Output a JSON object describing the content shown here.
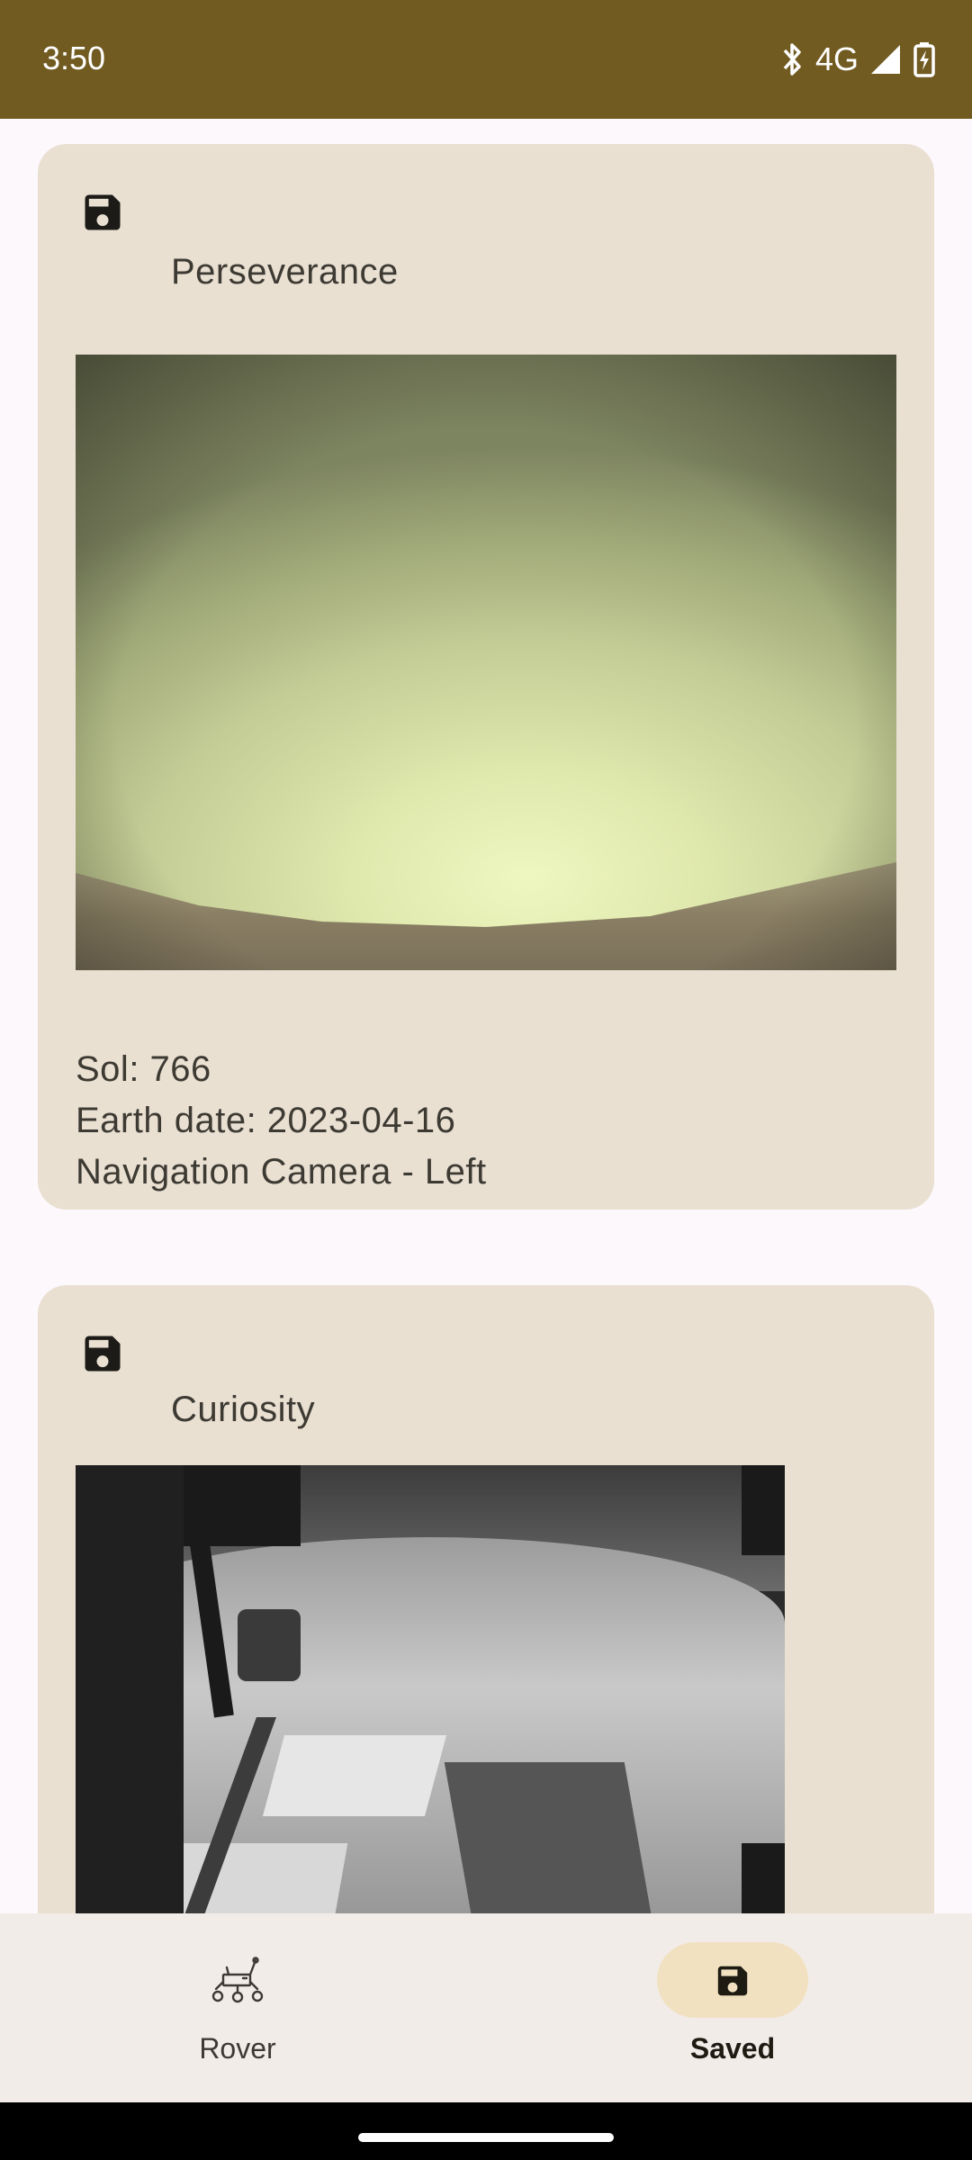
{
  "status_bar": {
    "time": "3:50",
    "network": "4G",
    "icons": [
      "bluetooth-icon",
      "signal-icon",
      "battery-charging-icon"
    ]
  },
  "cards": [
    {
      "rover_name": "Perseverance",
      "sol": "Sol: 766",
      "earth_date": "Earth date: 2023-04-16",
      "camera": "Navigation Camera - Left",
      "icon": "save-icon"
    },
    {
      "rover_name": "Curiosity",
      "icon": "save-icon"
    }
  ],
  "bottom_nav": {
    "items": [
      {
        "label": "Rover",
        "icon": "rover-icon",
        "selected": false
      },
      {
        "label": "Saved",
        "icon": "save-icon",
        "selected": true
      }
    ]
  },
  "colors": {
    "status_bar": "#715b21",
    "card_background": "#e9e0d2",
    "nav_selected_pill": "#f2e1c1",
    "nav_background": "#f1ece7"
  }
}
